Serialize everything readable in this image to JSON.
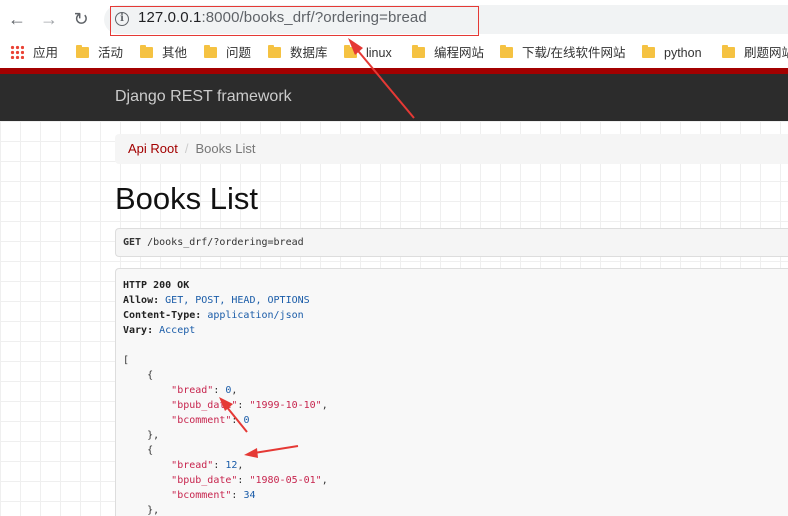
{
  "browser": {
    "url_host": "127.0.0.1",
    "url_path": ":8000/books_drf/?ordering=bread"
  },
  "bookmarks": [
    {
      "label": "应用",
      "icon": "apps-grid-icon"
    },
    {
      "label": "活动",
      "icon": "folder-icon"
    },
    {
      "label": "其他",
      "icon": "folder-icon"
    },
    {
      "label": "问题",
      "icon": "folder-icon"
    },
    {
      "label": "数据库",
      "icon": "folder-icon"
    },
    {
      "label": "linux",
      "icon": "folder-icon"
    },
    {
      "label": "编程网站",
      "icon": "folder-icon"
    },
    {
      "label": "下载/在线软件网站",
      "icon": "folder-icon"
    },
    {
      "label": "python",
      "icon": "folder-icon"
    },
    {
      "label": "刷题网站",
      "icon": "folder-icon"
    }
  ],
  "navbar": {
    "brand": "Django REST framework"
  },
  "breadcrumb": {
    "root": "Api Root",
    "separator": "/",
    "current": "Books List"
  },
  "page": {
    "title": "Books List"
  },
  "request": {
    "method": "GET",
    "path": "/books_drf/?ordering=bread"
  },
  "response": {
    "status": "HTTP 200 OK",
    "headers": [
      {
        "name": "Allow:",
        "value": "GET, POST, HEAD, OPTIONS"
      },
      {
        "name": "Content-Type:",
        "value": "application/json"
      },
      {
        "name": "Vary:",
        "value": "Accept"
      }
    ],
    "open_bracket": "[",
    "records": [
      {
        "bread": "0",
        "bpub_date": "\"1999-10-10\"",
        "bcomment": "0"
      },
      {
        "bread": "12",
        "bpub_date": "\"1980-05-01\"",
        "bcomment": "34"
      }
    ]
  },
  "colors": {
    "annotation_red": "#e53935",
    "navbar_bg": "#2c2c2c",
    "navbar_accent": "#a30000"
  }
}
